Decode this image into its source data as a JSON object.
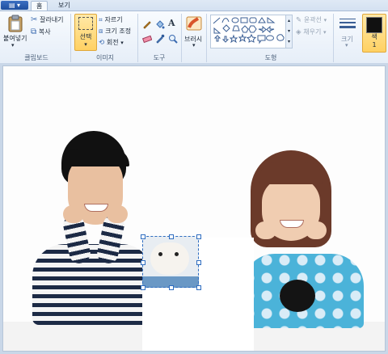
{
  "tabs": {
    "app_menu": "▤ ▾",
    "home": "홈",
    "view": "보기"
  },
  "clipboard": {
    "paste": "붙여넣기",
    "cut": "잘라내기",
    "copy": "복사",
    "group": "클립보드"
  },
  "image": {
    "select": "선택",
    "crop": "자르기",
    "resize": "크기 조정",
    "rotate": "회전",
    "group": "이미지"
  },
  "tools": {
    "group": "도구"
  },
  "brushes": {
    "label": "브러시"
  },
  "shapes": {
    "outline": "윤곽선",
    "fill": "채우기",
    "group": "도형"
  },
  "size": {
    "label": "크기"
  },
  "color": {
    "label": "색\n1",
    "value": "#111111"
  }
}
